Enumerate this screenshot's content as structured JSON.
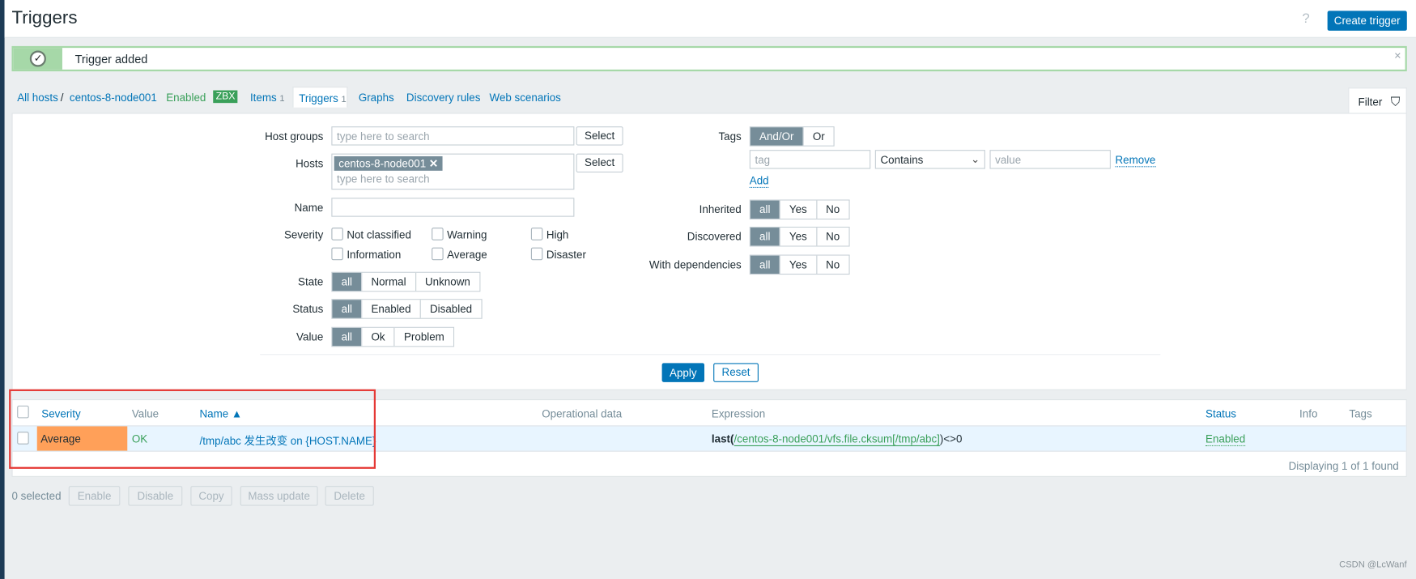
{
  "header": {
    "title": "Triggers",
    "help_icon": "question-icon",
    "create_label": "Create trigger"
  },
  "message": {
    "text": "Trigger added",
    "icon": "check-circle-icon",
    "close": "×"
  },
  "nav": {
    "all_hosts": "All hosts",
    "sep": "/",
    "host": "centos-8-node001",
    "status": "Enabled",
    "zbx": "ZBX",
    "items": "Items",
    "items_count": "1",
    "triggers": "Triggers",
    "triggers_count": "1",
    "graphs": "Graphs",
    "discovery": "Discovery rules",
    "web": "Web scenarios"
  },
  "filter": {
    "tab_label": "Filter",
    "host_groups_label": "Host groups",
    "search_placeholder": "type here to search",
    "select": "Select",
    "hosts_label": "Hosts",
    "host_chip": "centos-8-node001",
    "name_label": "Name",
    "name_value": "",
    "severity_label": "Severity",
    "severities": [
      "Not classified",
      "Warning",
      "High",
      "Information",
      "Average",
      "Disaster"
    ],
    "state_label": "State",
    "state_options": [
      "all",
      "Normal",
      "Unknown"
    ],
    "status_label": "Status",
    "status_options": [
      "all",
      "Enabled",
      "Disabled"
    ],
    "value_label": "Value",
    "value_options": [
      "all",
      "Ok",
      "Problem"
    ],
    "tags_label": "Tags",
    "tags_options": [
      "And/Or",
      "Or"
    ],
    "tag_placeholder": "tag",
    "operator": "Contains",
    "value_placeholder": "value",
    "remove": "Remove",
    "add": "Add",
    "inherited_label": "Inherited",
    "discovered_label": "Discovered",
    "deps_label": "With dependencies",
    "yn": [
      "all",
      "Yes",
      "No"
    ],
    "apply": "Apply",
    "reset": "Reset"
  },
  "table": {
    "headers": [
      "Severity",
      "Value",
      "Name ▲",
      "Operational data",
      "Expression",
      "Status",
      "Info",
      "Tags"
    ],
    "rows": [
      {
        "severity": "Average",
        "severity_color": "#ffa059",
        "value": "OK",
        "name": "/tmp/abc 发生改变 on {HOST.NAME}",
        "expr_fn": "last(",
        "expr_item": "/centos-8-node001/vfs.file.cksum[/tmp/abc]",
        "expr_rest": ")<>0",
        "status": "Enabled"
      }
    ],
    "footer": "Displaying 1 of 1 found"
  },
  "actions": {
    "selected": "0 selected",
    "buttons": [
      "Enable",
      "Disable",
      "Copy",
      "Mass update",
      "Delete"
    ]
  },
  "watermark": "CSDN @LcWanf"
}
